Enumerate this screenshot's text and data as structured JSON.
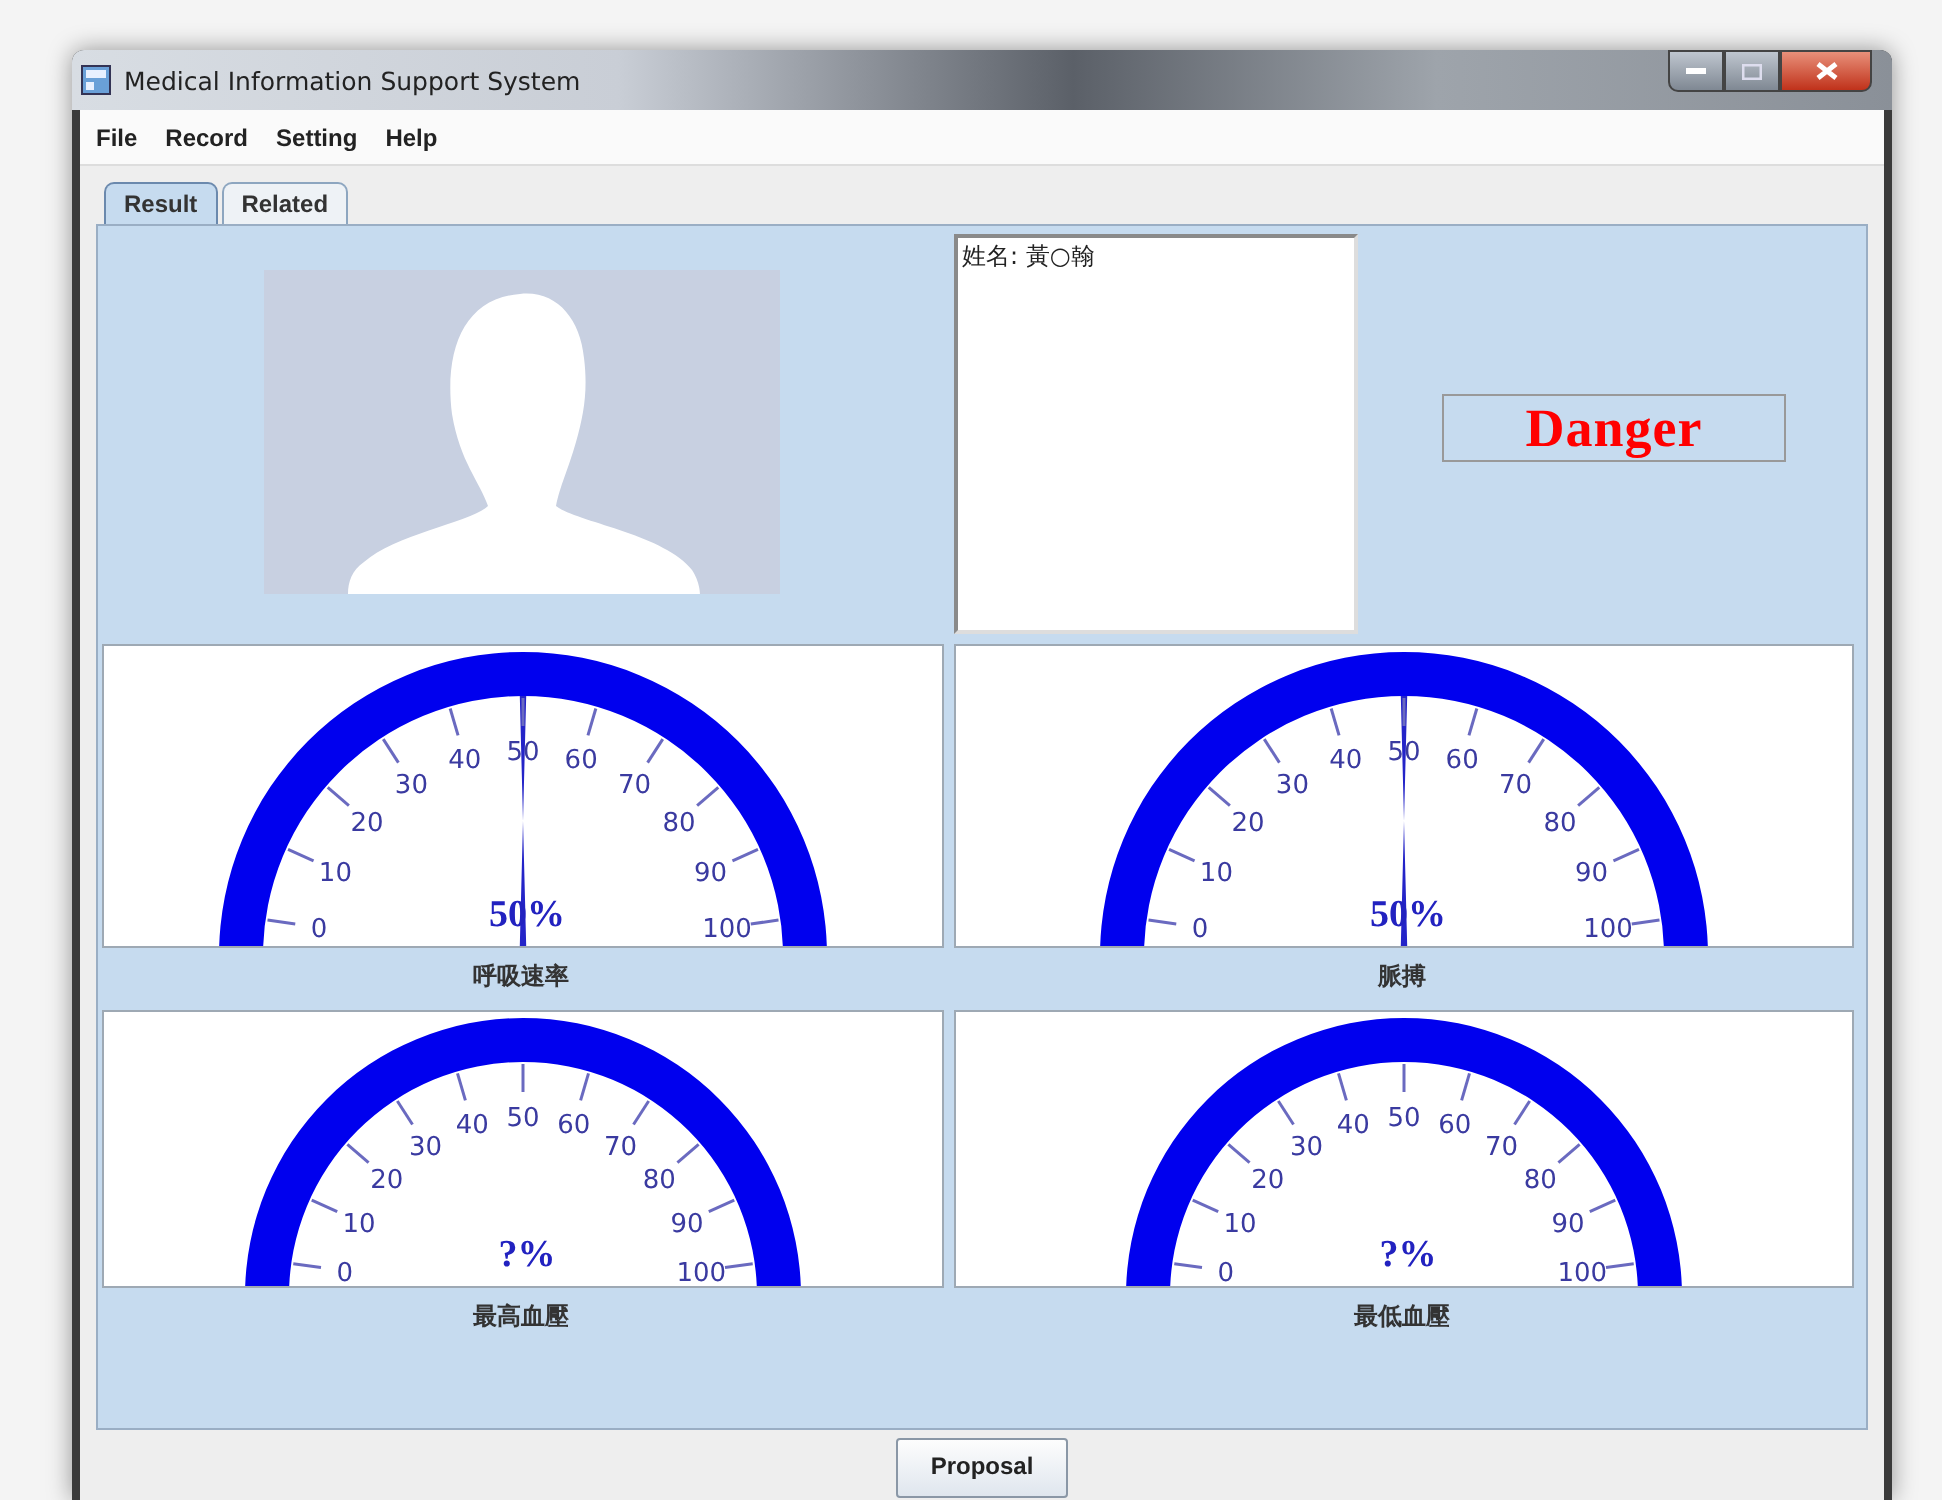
{
  "window": {
    "title": "Medical Information Support System"
  },
  "menu": [
    "File",
    "Record",
    "Setting",
    "Help"
  ],
  "tabs": [
    {
      "label": "Result",
      "selected": true
    },
    {
      "label": "Related",
      "selected": false
    }
  ],
  "info_box": {
    "value": "姓名: 黃○翰"
  },
  "alert": {
    "text": "Danger"
  },
  "gauges": [
    {
      "label": "呼吸速率",
      "reading": "50%",
      "level": 0.5,
      "ticks": [
        "0",
        "10",
        "20",
        "30",
        "40",
        "50",
        "60",
        "70",
        "80",
        "90",
        "100"
      ]
    },
    {
      "label": "脈搏",
      "reading": "50%",
      "level": 0.5,
      "ticks": [
        "0",
        "10",
        "20",
        "30",
        "40",
        "50",
        "60",
        "70",
        "80",
        "90",
        "100"
      ]
    },
    {
      "label": "最高血壓",
      "reading": "?%",
      "ticks": [
        "0",
        "10",
        "20",
        "30",
        "40",
        "50",
        "60",
        "70",
        "80",
        "90",
        "100"
      ]
    },
    {
      "label": "最低血壓",
      "reading": "?%",
      "ticks": [
        "0",
        "10",
        "20",
        "30",
        "40",
        "50",
        "60",
        "70",
        "80",
        "90",
        "100"
      ]
    }
  ],
  "buttons": [
    "Proposal"
  ]
}
